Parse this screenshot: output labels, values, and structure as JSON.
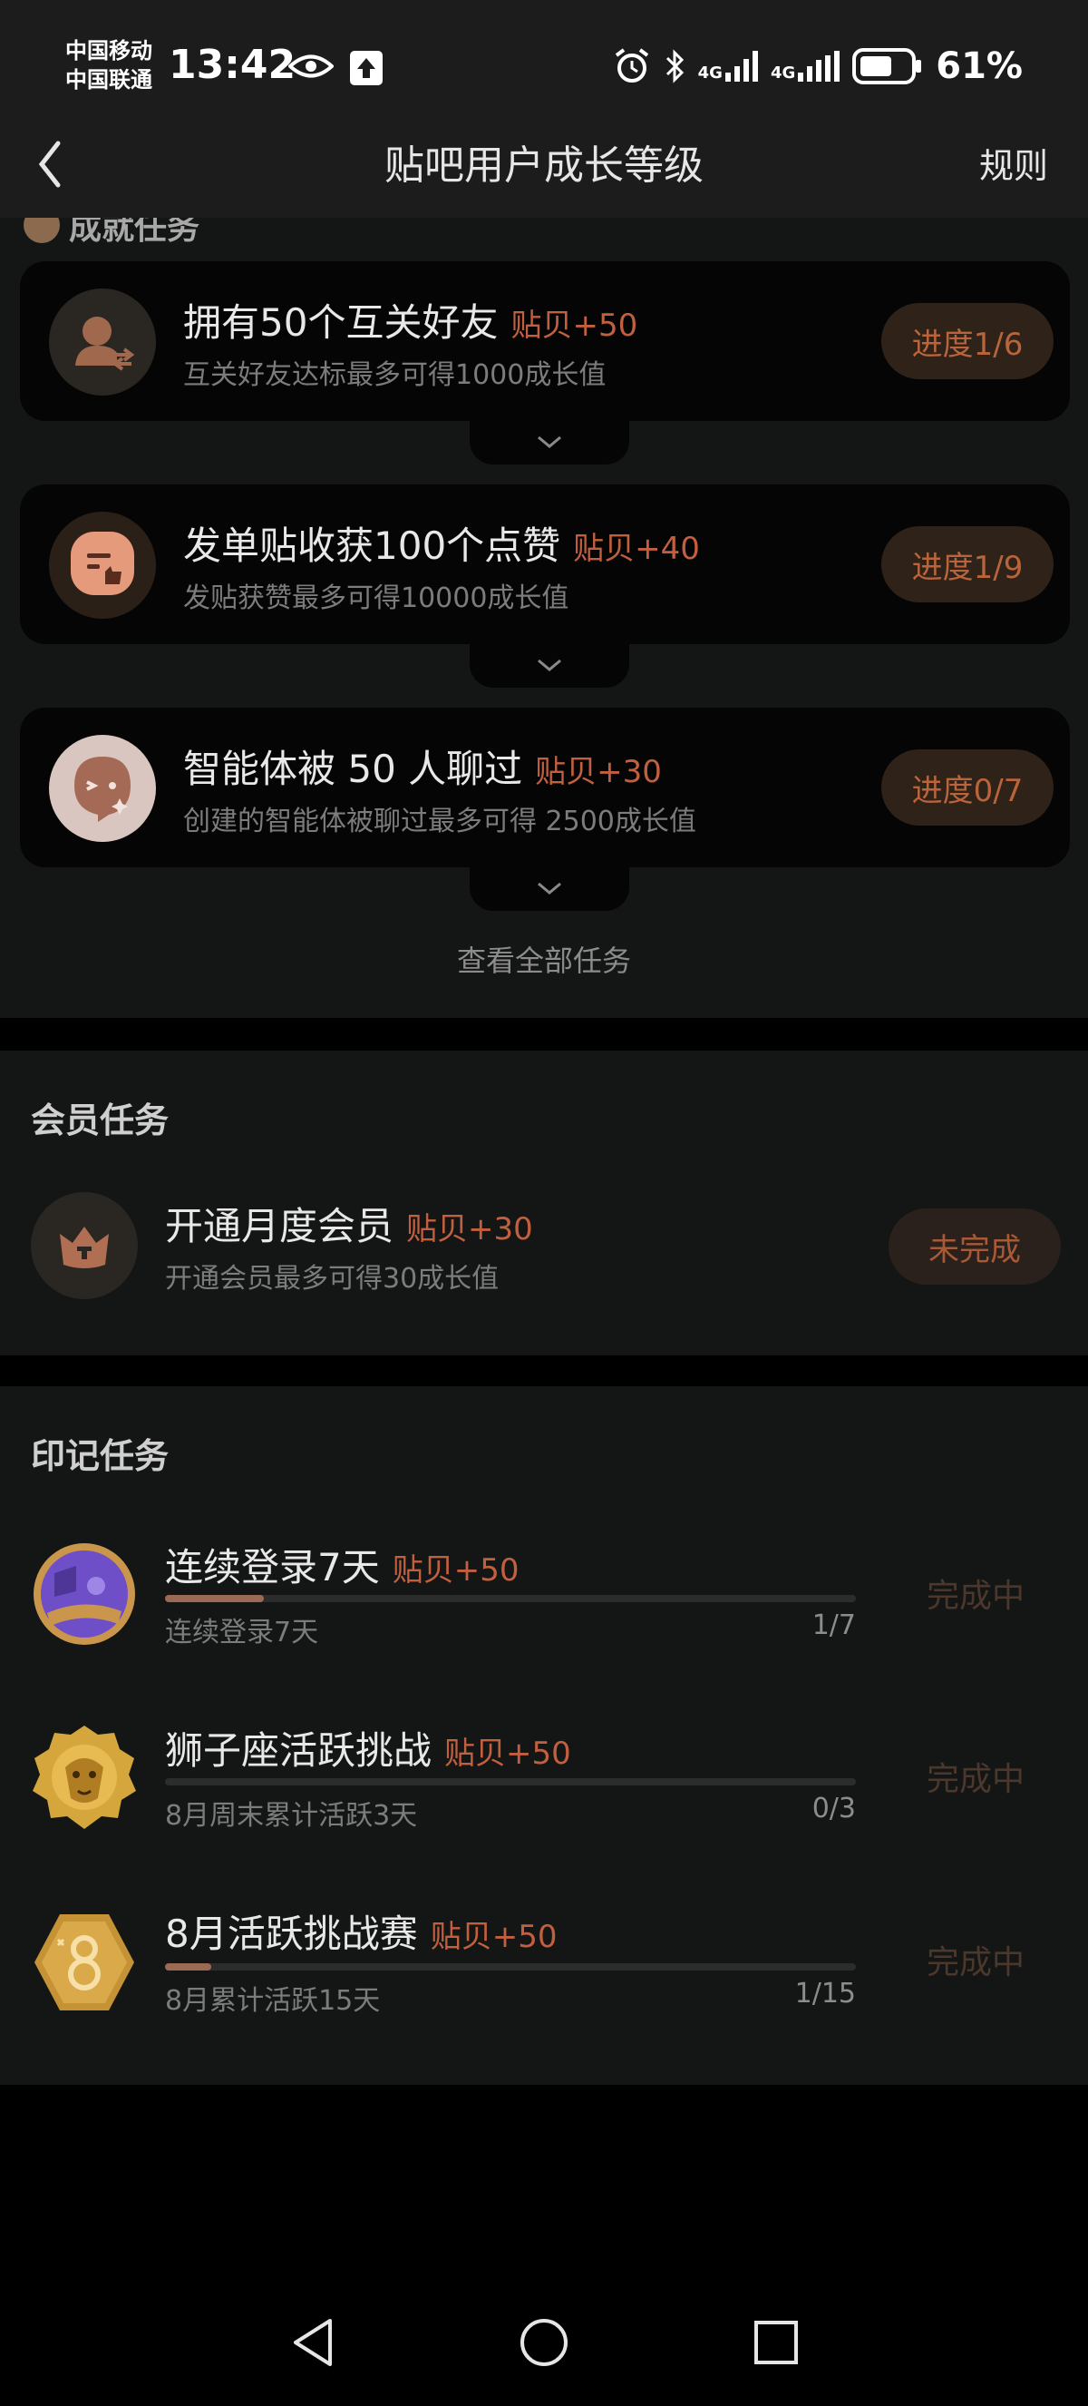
{
  "status_bar": {
    "carrier_1": "中国移动",
    "carrier_2": "中国联通",
    "time": "13:42",
    "signal_1": "4G",
    "signal_2": "4G",
    "battery": "61%"
  },
  "nav": {
    "title": "贴吧用户成长等级",
    "rules": "规则"
  },
  "achievement_section": {
    "title": "成就任务",
    "tasks": [
      {
        "title": "拥有50个互关好友",
        "reward": "贴贝+50",
        "desc": "互关好友达标最多可得1000成长值",
        "progress": "进度1/6"
      },
      {
        "title": "发单贴收获100个点赞",
        "reward": "贴贝+40",
        "desc": "发贴获赞最多可得10000成长值",
        "progress": "进度1/9"
      },
      {
        "title": "智能体被 50 人聊过",
        "reward": "贴贝+30",
        "desc": "创建的智能体被聊过最多可得 2500成长值",
        "progress": "进度0/7"
      }
    ],
    "view_all": "查看全部任务"
  },
  "member_section": {
    "title": "会员任务",
    "task": {
      "title": "开通月度会员",
      "reward": "贴贝+30",
      "desc": "开通会员最多可得30成长值",
      "status": "未完成"
    }
  },
  "mark_section": {
    "title": "印记任务",
    "tasks": [
      {
        "title": "连续登录7天",
        "reward": "贴贝+50",
        "desc": "连续登录7天",
        "count": "1/7",
        "fraction": 0.143,
        "status": "完成中"
      },
      {
        "title": "狮子座活跃挑战",
        "reward": "贴贝+50",
        "desc": "8月周末累计活跃3天",
        "count": "0/3",
        "fraction": 0,
        "status": "完成中"
      },
      {
        "title": "8月活跃挑战赛",
        "reward": "贴贝+50",
        "desc": "8月累计活跃15天",
        "count": "1/15",
        "fraction": 0.067,
        "status": "完成中"
      }
    ]
  },
  "colors": {
    "accent_reward": "#c25f3f",
    "progress_pill_bg": "#2f2219",
    "card_bg": "#050505",
    "section_bg": "#131614"
  }
}
